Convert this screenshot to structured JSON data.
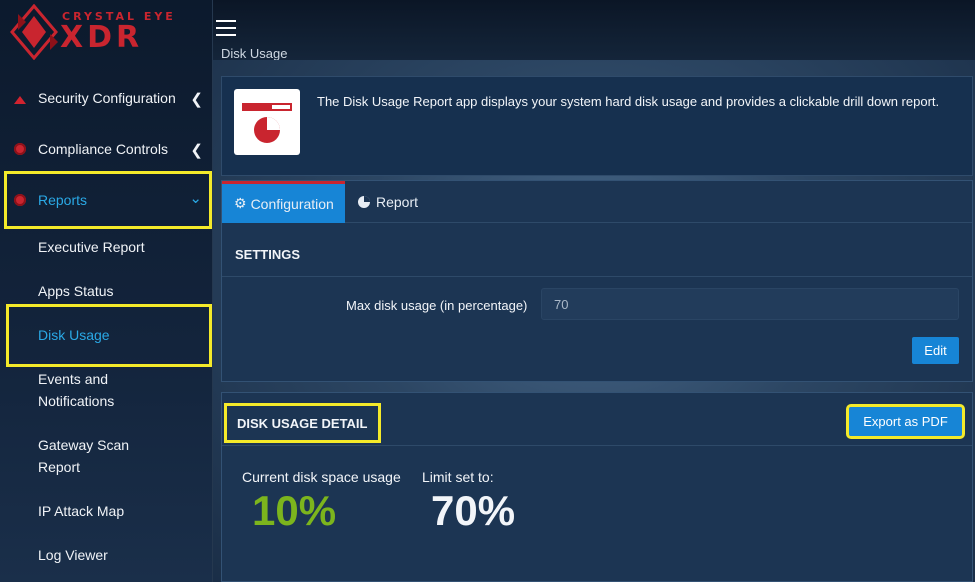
{
  "app": {
    "logo_top": "CRYSTAL EYE",
    "logo_main": "XDR",
    "page_title": "Disk Usage"
  },
  "sidebar": {
    "items": [
      {
        "label": "Security Configuration",
        "icon": "warning-triangle-icon"
      },
      {
        "label": "Compliance Controls",
        "icon": "compliance-icon"
      },
      {
        "label": "Reports",
        "icon": "reports-icon"
      }
    ],
    "sub_items": [
      {
        "label": "Executive Report"
      },
      {
        "label": "Apps Status"
      },
      {
        "label": "Disk Usage"
      },
      {
        "label_l1": "Events and",
        "label_l2": "Notifications"
      },
      {
        "label_l1": "Gateway Scan",
        "label_l2": "Report"
      },
      {
        "label": "IP Attack Map"
      },
      {
        "label": "Log Viewer"
      }
    ]
  },
  "info": {
    "description": "The Disk Usage Report app displays your system hard disk usage and provides a clickable drill down report."
  },
  "tabs": [
    {
      "label": "Configuration",
      "icon": "gear-icon"
    },
    {
      "label": "Report",
      "icon": "pie-chart-icon"
    }
  ],
  "settings": {
    "title": "SETTINGS",
    "max_disk_label": "Max disk usage (in percentage)",
    "max_disk_value": "70",
    "edit_label": "Edit"
  },
  "detail": {
    "title": "DISK USAGE DETAIL",
    "export_label": "Export as PDF",
    "current_label": "Current disk space usage",
    "current_value": "10%",
    "limit_label": "Limit set to:",
    "limit_value": "70%"
  },
  "colors": {
    "accent": "#1785d6",
    "brand_red": "#c9252f",
    "highlight": "#f4ea2a",
    "usage_green": "#7cb51d"
  }
}
